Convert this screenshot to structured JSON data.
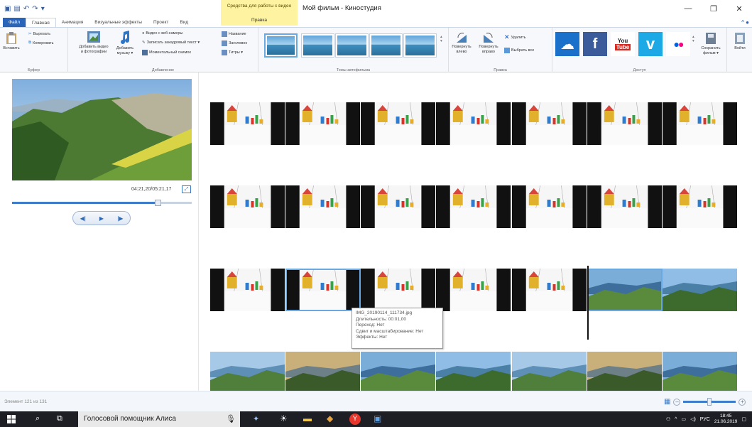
{
  "window": {
    "title": "Мой фильм - Киностудия",
    "contextual_tab_group": "Средства для работы с видео",
    "contextual_tab": "Правка"
  },
  "tabs": [
    "Файл",
    "Главная",
    "Анимация",
    "Визуальные эффекты",
    "Проект",
    "Вид"
  ],
  "ribbon": {
    "clipboard": {
      "label": "Буфер",
      "paste": "Вставить",
      "cut": "Вырезать",
      "copy": "Копировать"
    },
    "add": {
      "label": "Добавление",
      "add_video_photo": [
        "Добавить видео",
        "и фотографии"
      ],
      "add_music": [
        "Добавить",
        "музыку ▾"
      ],
      "webcam": "Видео с веб-камеры",
      "narration": "Записать закадровый текст ▾",
      "snapshot": "Моментальный снимок",
      "title": "Название",
      "caption": "Заголовок",
      "credits": "Титры ▾"
    },
    "themes": {
      "label": "Темы автофильма"
    },
    "editing": {
      "label": "Правка",
      "rotate_left": [
        "Повернуть",
        "влево"
      ],
      "rotate_right": [
        "Повернуть",
        "вправо"
      ],
      "delete": "Удалить",
      "select_all": "Выбрать все"
    },
    "share": {
      "label": "Доступ",
      "save_movie": [
        "Сохранить",
        "фильм ▾"
      ],
      "sign_in": "Войти"
    }
  },
  "preview": {
    "timecode": "04:21,20/05:21,17",
    "progress": 0.81
  },
  "tooltip": {
    "filename": "IMG_20190114_111734.jpg",
    "duration": "Длительность: 00:01,00",
    "transition": "Переход: Нет",
    "pan_zoom": "Сдвиг и масштабирование: Нет",
    "effects": "Эффекты: Нет"
  },
  "status": {
    "item": "Элемент 121 из 131"
  },
  "taskbar": {
    "search": "Голосовой помощник Алиса",
    "lang": "РУС",
    "time": "18:45",
    "date": "21.06.2019"
  },
  "colors": {
    "accent": "#2a64b8",
    "contextual": "#fdf3a0",
    "selection": "#6aa8e4"
  }
}
